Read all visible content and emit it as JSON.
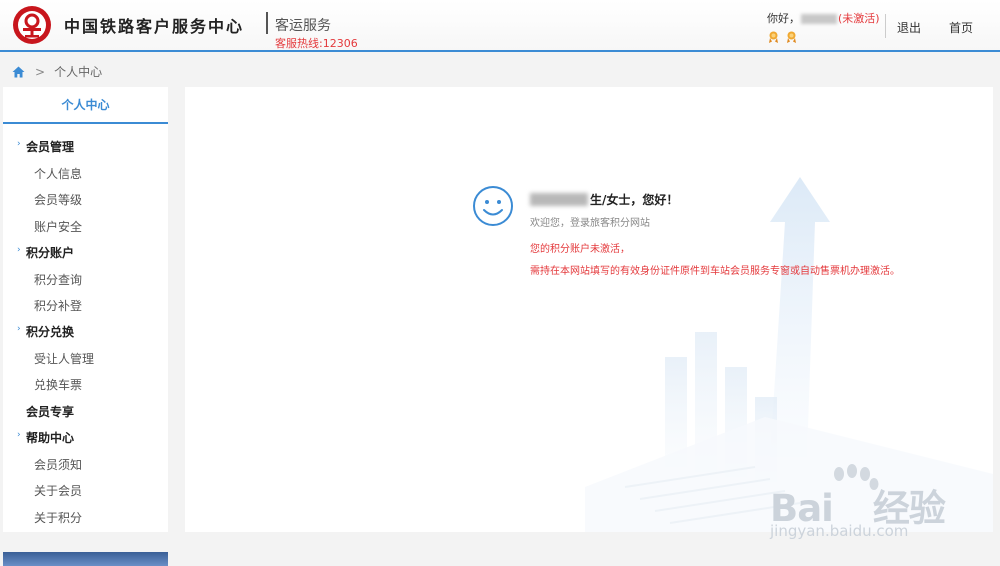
{
  "header": {
    "brand": "中国铁路客户服务中心",
    "service": "客运服务",
    "hotline": "客服热线:12306",
    "greeting_prefix": "你好，",
    "status": "(未激活)",
    "logout": "退出",
    "home": "首页"
  },
  "breadcrumb": {
    "separator": ">",
    "current": "个人中心"
  },
  "sidebar": {
    "title": "个人中心",
    "groups": [
      {
        "label": "会员管理",
        "items": [
          "个人信息",
          "会员等级",
          "账户安全"
        ]
      },
      {
        "label": "积分账户",
        "items": [
          "积分查询",
          "积分补登"
        ]
      },
      {
        "label": "积分兑换",
        "items": [
          "受让人管理",
          "兑换车票"
        ]
      },
      {
        "label": "会员专享",
        "items": []
      },
      {
        "label": "帮助中心",
        "items": [
          "会员须知",
          "关于会员",
          "关于积分"
        ]
      }
    ]
  },
  "main": {
    "salutation": "生/女士，您好！",
    "welcome": "欢迎您，登录旅客积分网站",
    "warning_line1": "您的积分账户未激活，",
    "warning_line2": "需持在本网站填写的有效身份证件原件到车站会员服务专窗或自动售票机办理激活。"
  },
  "watermark": {
    "logo_text": "Bai",
    "logo_text2": "经验",
    "domain": "jingyan.baidu.com"
  },
  "colors": {
    "accent": "#3b8bd4",
    "warning": "#e4393c",
    "logo_red": "#c8161d"
  }
}
